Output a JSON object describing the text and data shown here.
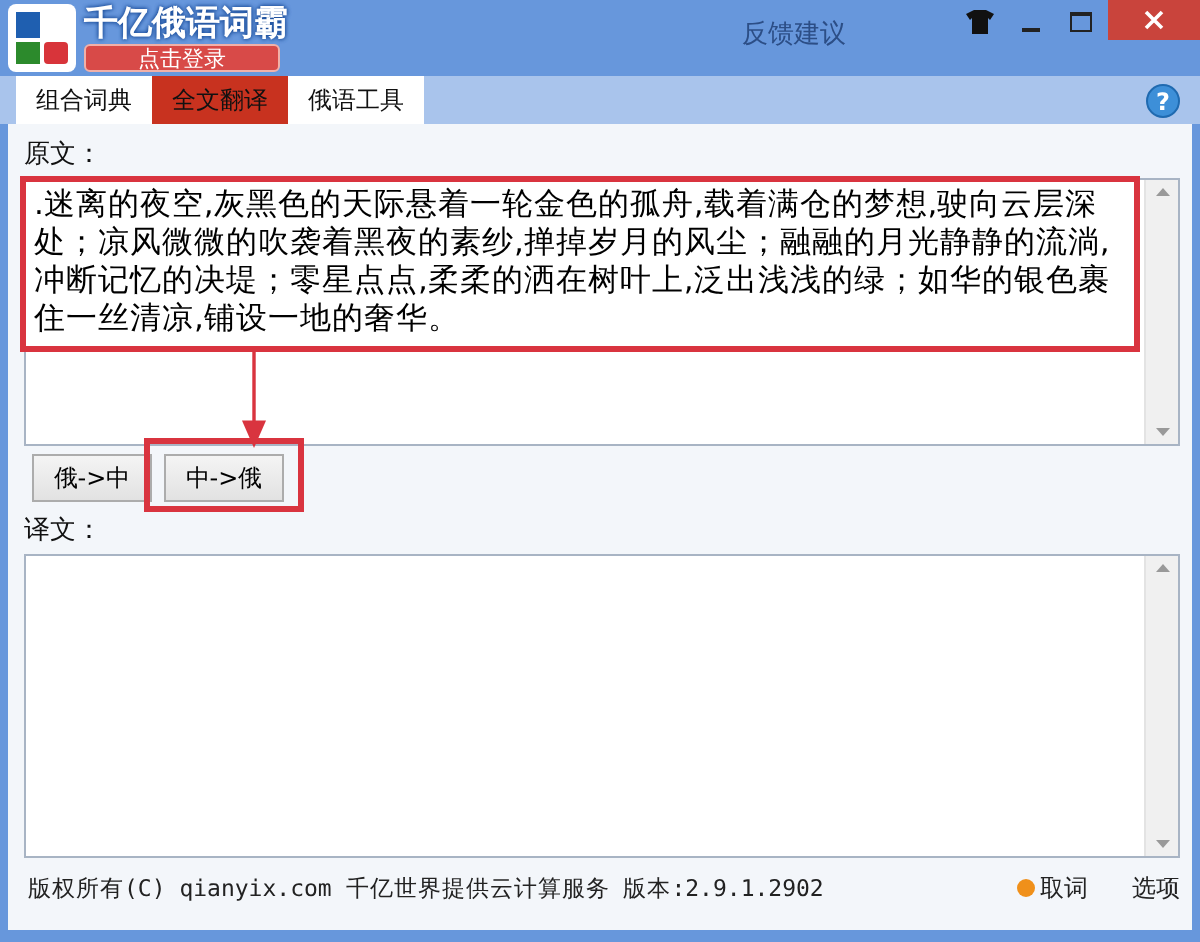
{
  "window": {
    "title": "千亿俄语词霸",
    "login_button": "点击登录",
    "feedback_link": "反馈建议"
  },
  "tabs": [
    {
      "label": "组合词典",
      "selected": false
    },
    {
      "label": "全文翻译",
      "selected": true
    },
    {
      "label": "俄语工具",
      "selected": false
    }
  ],
  "help_button": "?",
  "source": {
    "label": "原文：",
    "value": ".迷离的夜空,灰黑色的天际悬着一轮金色的孤舟,载着满仓的梦想,驶向云层深处；凉风微微的吹袭着黑夜的素纱,掸掉岁月的风尘；融融的月光静静的流淌,冲断记忆的决堤；零星点点,柔柔的洒在树叶上,泛出浅浅的绿；如华的银色裹住一丝清凉,铺设一地的奢华。"
  },
  "direction_buttons": [
    "俄->中",
    "中->俄"
  ],
  "translation": {
    "label": "译文："
  },
  "annotations": [
    {
      "kind": "box"
    },
    {
      "kind": "arrow"
    },
    {
      "kind": "button-box"
    }
  ],
  "status_bar": {
    "copyright": "版权所有(C) qianyix.com 千亿世界提供云计算服务 版本:2.9.1.2902",
    "lookup": "取词",
    "options": "选项"
  }
}
